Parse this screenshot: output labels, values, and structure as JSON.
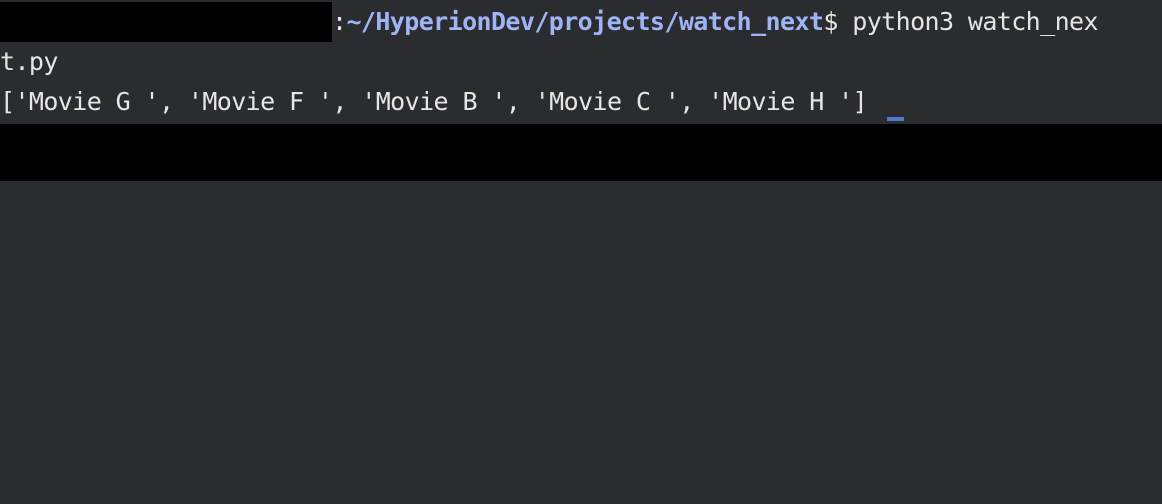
{
  "terminal": {
    "prompt": {
      "user_host_redacted": true,
      "separator": ":",
      "path": "~/HyperionDev/projects/watch_next",
      "symbol": "$"
    },
    "command_part1": " python3 watch_nex",
    "command_part2": "t.py",
    "output": "['Movie G ', 'Movie F ', 'Movie B ', 'Movie C ', 'Movie H ']"
  },
  "colors": {
    "background": "#2b2c2f",
    "text": "#e6e6e6",
    "path": "#9fb4f4",
    "cursor": "#4e78c8",
    "redaction": "#000000"
  }
}
